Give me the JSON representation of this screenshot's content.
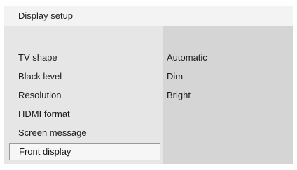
{
  "window": {
    "title": "Display setup"
  },
  "menu": {
    "items": [
      {
        "label": "TV shape"
      },
      {
        "label": "Black level"
      },
      {
        "label": "Resolution"
      },
      {
        "label": "HDMI format"
      },
      {
        "label": "Screen message"
      },
      {
        "label": "Front display"
      }
    ],
    "selected_label": "Front display"
  },
  "options": {
    "items": [
      {
        "label": "Automatic"
      },
      {
        "label": "Dim"
      },
      {
        "label": "Bright"
      }
    ]
  },
  "colors": {
    "title_bar": "#f3f3f3",
    "menu_background": "#e6e6e6",
    "options_background": "#d5d5d5",
    "selection_border": "#9a9a9a"
  }
}
